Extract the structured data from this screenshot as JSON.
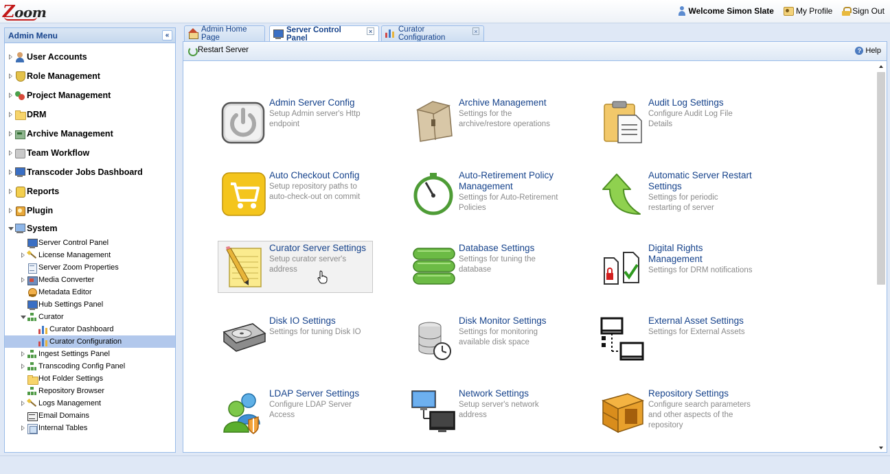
{
  "app": {
    "logo": "Zoom"
  },
  "header": {
    "welcome": "Welcome Simon Slate",
    "my_profile": "My Profile",
    "sign_out": "Sign Out"
  },
  "sidebar": {
    "title": "Admin Menu",
    "top_items": [
      {
        "label": "User Accounts",
        "icon": "users-icon"
      },
      {
        "label": "Role Management",
        "icon": "shield-icon"
      },
      {
        "label": "Project Management",
        "icon": "project-icon"
      },
      {
        "label": "DRM",
        "icon": "folder-icon"
      },
      {
        "label": "Archive Management",
        "icon": "archive-icon"
      },
      {
        "label": "Team Workflow",
        "icon": "workflow-icon"
      },
      {
        "label": "Transcoder Jobs Dashboard",
        "icon": "monitor-icon"
      },
      {
        "label": "Reports",
        "icon": "report-icon"
      },
      {
        "label": "Plugin",
        "icon": "plugin-icon"
      },
      {
        "label": "System",
        "icon": "system-icon"
      }
    ],
    "system_items": [
      {
        "label": "Server Control Panel",
        "icon": "monitor-icon"
      },
      {
        "label": "License Management",
        "icon": "wand-icon"
      },
      {
        "label": "Server Zoom Properties",
        "icon": "document-icon"
      },
      {
        "label": "Media Converter",
        "icon": "media-icon"
      },
      {
        "label": "Metadata Editor",
        "icon": "metadata-icon"
      },
      {
        "label": "Hub Settings Panel",
        "icon": "monitor-icon"
      },
      {
        "label": "Curator",
        "icon": "network-icon"
      },
      {
        "label": "Curator Dashboard",
        "icon": "chart-icon"
      },
      {
        "label": "Curator Configuration",
        "icon": "chart-icon"
      },
      {
        "label": "Ingest Settings Panel",
        "icon": "network-icon"
      },
      {
        "label": "Transcoding Config Panel",
        "icon": "network-icon"
      },
      {
        "label": "Hot Folder Settings",
        "icon": "folder-icon"
      },
      {
        "label": "Repository Browser",
        "icon": "network-icon"
      },
      {
        "label": "Logs Management",
        "icon": "wand-icon"
      },
      {
        "label": "Email Domains",
        "icon": "email-icon"
      },
      {
        "label": "Internal Tables",
        "icon": "tables-icon"
      }
    ]
  },
  "tabs": [
    {
      "label": "Admin Home Page",
      "icon": "home-icon"
    },
    {
      "label": "Server Control Panel",
      "icon": "monitor-icon"
    },
    {
      "label": "Curator Configuration",
      "icon": "chart-icon"
    }
  ],
  "toolbar": {
    "restart_label": "Restart Server",
    "help_label": "Help"
  },
  "tiles": [
    {
      "title": "Admin Server Config",
      "desc": "Setup Admin server's Http endpoint",
      "icon": "power-icon"
    },
    {
      "title": "Archive Management",
      "desc": "Settings for the archive/restore operations",
      "icon": "box-icon"
    },
    {
      "title": "Audit Log Settings",
      "desc": "Configure Audit Log File Details",
      "icon": "clipboard-icon"
    },
    {
      "title": "Auto Checkout Config",
      "desc": "Setup repository paths to auto-check-out on commit",
      "icon": "cart-icon"
    },
    {
      "title": "Auto-Retirement Policy Management",
      "desc": "Settings for Auto-Retirement Policies",
      "icon": "stopwatch-icon"
    },
    {
      "title": "Automatic Server Restart Settings",
      "desc": "Settings for periodic restarting of server",
      "icon": "green-arrow-icon"
    },
    {
      "title": "Curator Server Settings",
      "desc": "Setup curator server's address",
      "icon": "notepad-icon"
    },
    {
      "title": "Database Settings",
      "desc": "Settings for tuning the database",
      "icon": "database-icon"
    },
    {
      "title": "Digital Rights Management",
      "desc": "Settings for DRM notifications",
      "icon": "drm-documents-icon"
    },
    {
      "title": "Disk IO Settings",
      "desc": "Settings for tuning Disk IO",
      "icon": "hard-disk-icon"
    },
    {
      "title": "Disk Monitor Settings",
      "desc": "Settings for monitoring available disk space",
      "icon": "disk-clock-icon"
    },
    {
      "title": "External Asset Settings",
      "desc": "Settings for External Assets",
      "icon": "external-monitors-icon"
    },
    {
      "title": "LDAP Server Settings",
      "desc": "Configure LDAP Server Access",
      "icon": "ldap-users-icon"
    },
    {
      "title": "Network Settings",
      "desc": "Setup server's network address",
      "icon": "network-computers-icon"
    },
    {
      "title": "Repository Settings",
      "desc": "Configure search parameters and other aspects of the repository",
      "icon": "crate-icon"
    }
  ]
}
